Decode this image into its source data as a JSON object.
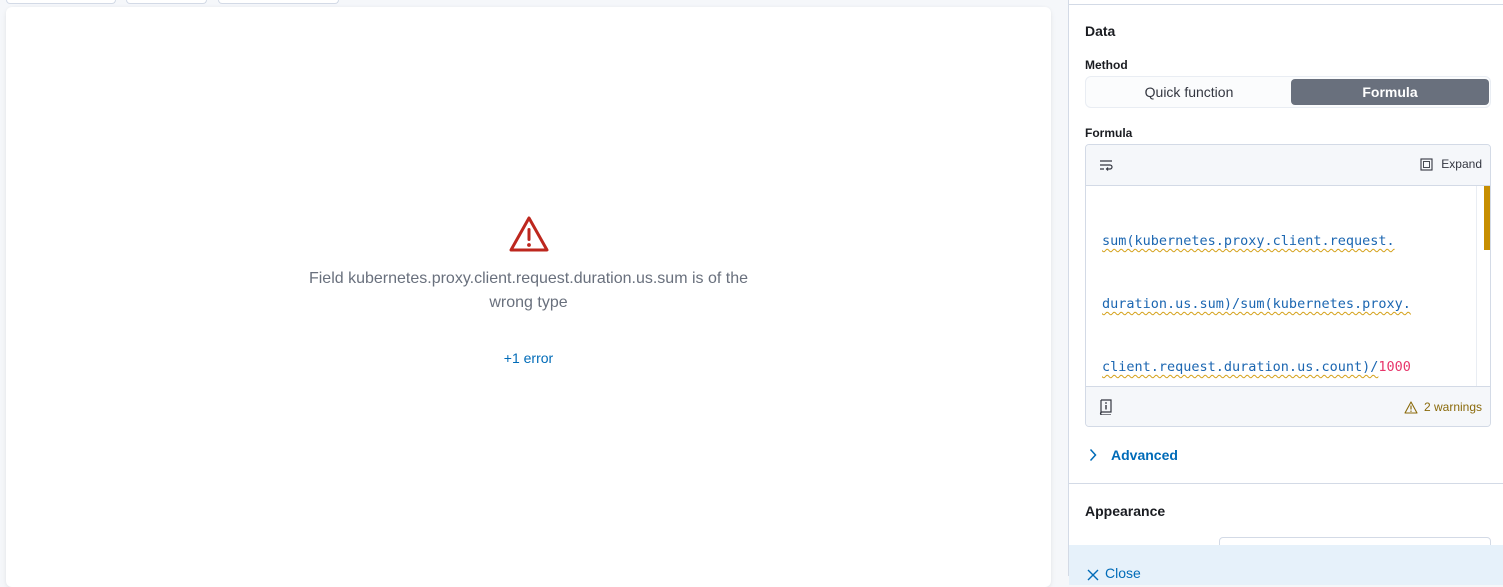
{
  "error_panel": {
    "message": "Field kubernetes.proxy.client.request.duration.us.sum is of the wrong type",
    "more_errors_link": "+1 error",
    "icon": "alert-triangle-icon",
    "icon_color": "#bd271e"
  },
  "flyout": {
    "data_section_title": "Data",
    "method_label": "Method",
    "method_options": {
      "quick": "Quick function",
      "formula": "Formula"
    },
    "selected_method": "Formula",
    "formula_label": "Formula",
    "editor": {
      "wrap_icon": "word-wrap-icon",
      "expand_label": "Expand",
      "expand_icon": "fullscreen-icon",
      "code_lines": [
        {
          "text": "sum(kubernetes.proxy.client.request."
        },
        {
          "text": "duration.us.sum)/sum(kubernetes.proxy."
        },
        {
          "text": "client.request.duration.us.count)/",
          "num": "1000"
        }
      ],
      "docs_icon": "documentation-icon",
      "warnings_label": "2 warnings",
      "warning_icon": "warning-icon"
    },
    "advanced_label": "Advanced",
    "appearance_title": "Appearance",
    "close_label": "Close"
  },
  "colors": {
    "accent": "#006bb8",
    "selected_button": "#69707d",
    "warning": "#c78e00",
    "danger": "#bd271e"
  }
}
